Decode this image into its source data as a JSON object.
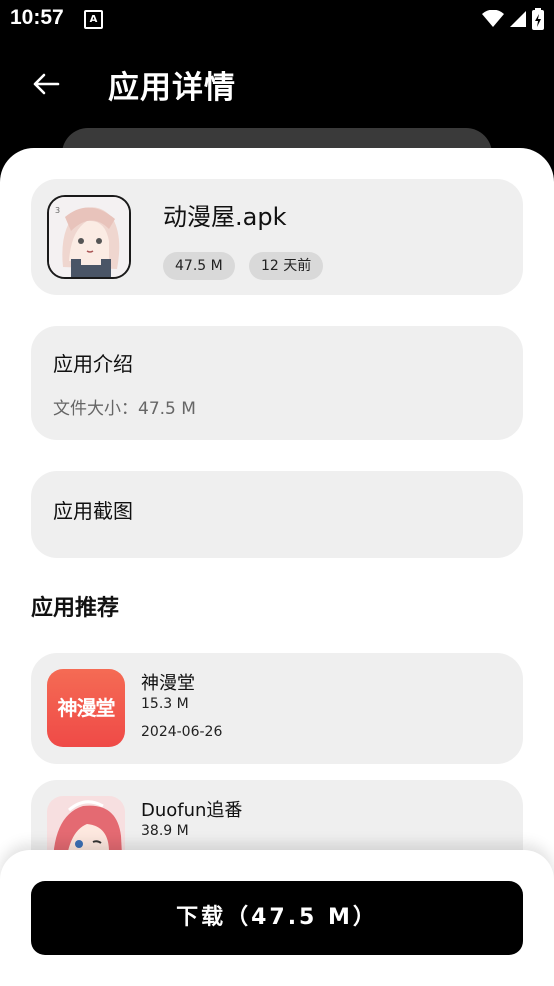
{
  "status_bar": {
    "time": "10:57",
    "notif_glyph": "A"
  },
  "app_bar": {
    "title": "应用详情",
    "back_icon": "arrow-left-icon"
  },
  "app": {
    "name": "动漫屋.apk",
    "size_tag": "47.5 M",
    "time_tag": "12 天前"
  },
  "intro": {
    "heading": "应用介绍",
    "file_size_line": "文件大小：47.5 M"
  },
  "screenshots": {
    "heading": "应用截图"
  },
  "recommend": {
    "heading": "应用推荐",
    "items": [
      {
        "name": "神漫堂",
        "size": "15.3 M",
        "date": "2024-06-26",
        "icon_text": "神漫堂"
      },
      {
        "name": "Duofun追番",
        "size": "38.9 M"
      }
    ]
  },
  "download": {
    "label": "下载（47.5 M）"
  },
  "colors": {
    "accent": "#000000",
    "card_bg": "#efefef",
    "tag_bg": "#d9d9d9",
    "rec_icon1": "#f2554a"
  }
}
